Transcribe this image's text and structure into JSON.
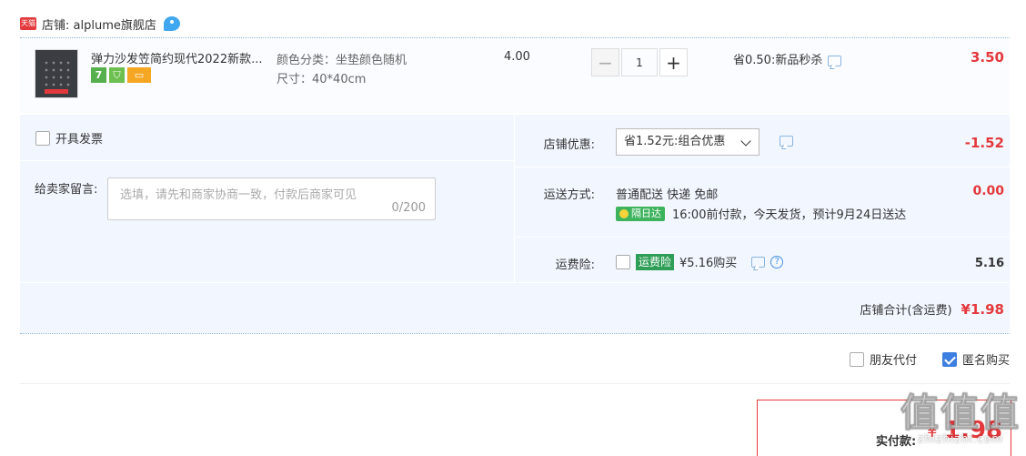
{
  "shop": {
    "badge": "天猫",
    "label": "店铺: alplume旗舰店"
  },
  "item": {
    "title": "弹力沙发笠简约现代2022新款...",
    "sku_color": "颜色分类：坐垫颜色随机",
    "sku_size": "尺寸：40*40cm",
    "unit_price": "4.00",
    "quantity": "1",
    "promo": "省0.50:新品秒杀",
    "total": "3.50",
    "badges": [
      "7"
    ]
  },
  "invoice": {
    "label": "开具发票"
  },
  "message": {
    "label": "给卖家留言:",
    "placeholder": "选填，请先和商家协商一致，付款后商家可见",
    "count": "0/200"
  },
  "shop_discount": {
    "label": "店铺优惠:",
    "selected": "省1.52元:组合优惠",
    "amount": "-1.52"
  },
  "shipping": {
    "label": "运送方式:",
    "method": "普通配送 快递 免邮",
    "tag": "隔日达",
    "note": "16:00前付款，今天发货，预计9月24日送达",
    "amount": "0.00"
  },
  "insurance": {
    "label": "运费险:",
    "tag": "运费险",
    "price": "¥5.16购买",
    "help": "?",
    "amount": "5.16"
  },
  "shop_total": {
    "label": "店铺合计(含运费)",
    "amount": "¥1.98"
  },
  "options": {
    "friend_pay": "朋友代付",
    "anonymous": "匿名购买"
  },
  "payment": {
    "label": "实付款:",
    "currency": "¥",
    "amount": "1.98"
  },
  "watermark": {
    "text": "值值值",
    "url": "zhizhizhi.com"
  },
  "colors": {
    "accent": "#e4393c",
    "panel": "#f2f7ff",
    "checkbox": "#3c7fe0"
  }
}
